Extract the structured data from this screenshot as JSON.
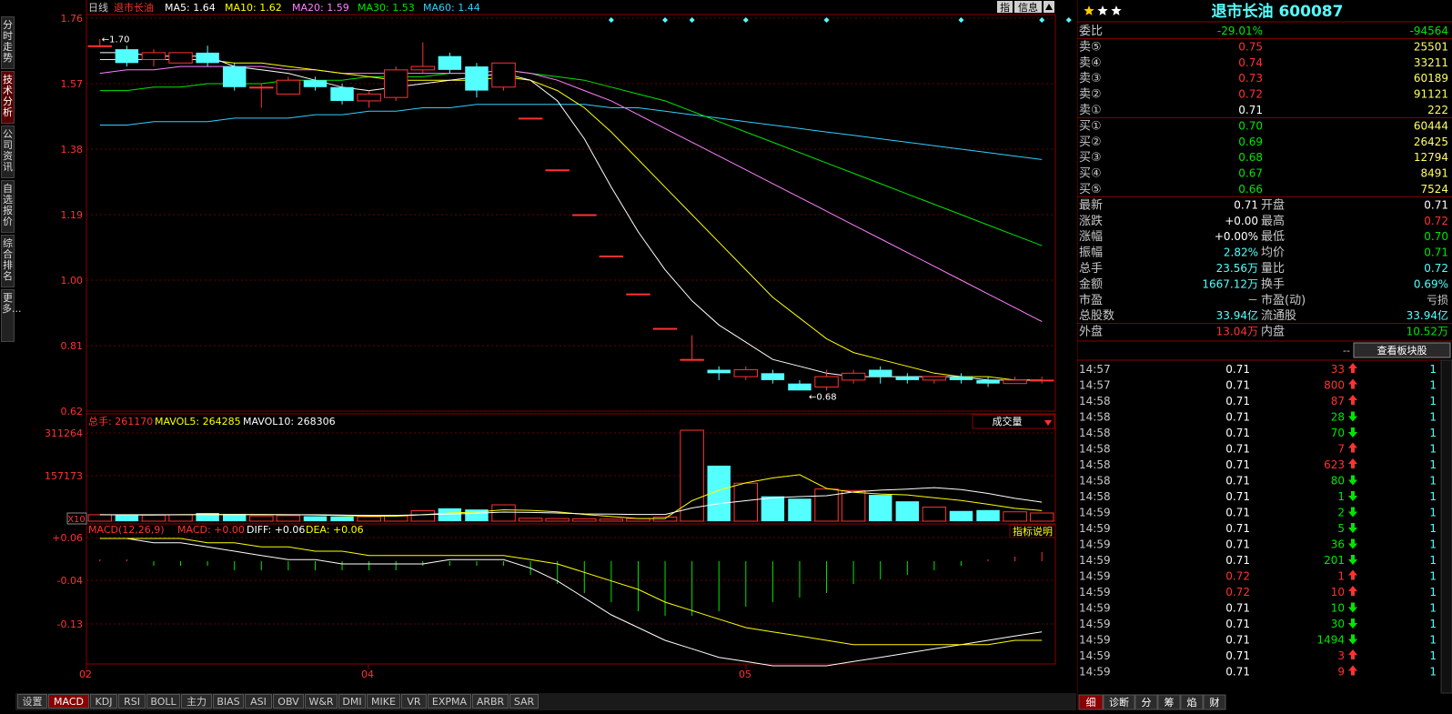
{
  "sidebar": {
    "tabs": [
      {
        "label": "分时走势",
        "active": false
      },
      {
        "label": "技术分析",
        "active": true
      },
      {
        "label": "公司资讯",
        "active": false
      },
      {
        "label": "自选报价",
        "active": false
      },
      {
        "label": "综合排名",
        "active": false
      },
      {
        "label": "更多...",
        "active": false
      }
    ]
  },
  "header": {
    "period": "日线",
    "stock_name": "退市长油",
    "ma5": "MA5: 1.64",
    "ma10": "MA10: 1.62",
    "ma20": "MA20: 1.59",
    "ma30": "MA30: 1.53",
    "ma60": "MA60: 1.44",
    "btn_zi": "指",
    "btn_info": "信息"
  },
  "price_axis": [
    "1.76",
    "1.57",
    "1.38",
    "1.19",
    "1.00",
    "0.81",
    "0.62"
  ],
  "annot": {
    "high": "←1.70",
    "low": "←0.68"
  },
  "vol_header": {
    "total": "总手: 261170",
    "mavol5": "MAVOL5: 264285",
    "mavol10": "MAVOL10: 268306",
    "dropdown": "成交量"
  },
  "vol_axis": [
    "311264",
    "157173",
    "X10"
  ],
  "macd_header": {
    "title": "MACD(12,26,9)",
    "macd": "MACD: +0.00",
    "diff": "DIFF: +0.06",
    "dea": "DEA: +0.06",
    "explain": "指标说明"
  },
  "macd_axis": [
    "+0.06",
    "-0.04",
    "-0.13"
  ],
  "x_axis": [
    "02",
    "04",
    "05"
  ],
  "colors": {
    "up": "#ff3232",
    "down": "#54ffff",
    "ma5": "#ffffff",
    "ma10": "#ffff00",
    "ma20": "#ff80ff",
    "ma30": "#00e600",
    "ma60": "#30d0ff"
  },
  "chart_data": {
    "type": "candlestick",
    "candles": [
      {
        "o": 1.68,
        "c": 1.68,
        "h": 1.7,
        "l": 1.68
      },
      {
        "o": 1.67,
        "c": 1.63,
        "h": 1.68,
        "l": 1.62
      },
      {
        "o": 1.64,
        "c": 1.66,
        "h": 1.67,
        "l": 1.62
      },
      {
        "o": 1.63,
        "c": 1.66,
        "h": 1.66,
        "l": 1.63
      },
      {
        "o": 1.66,
        "c": 1.63,
        "h": 1.68,
        "l": 1.62
      },
      {
        "o": 1.62,
        "c": 1.56,
        "h": 1.63,
        "l": 1.55
      },
      {
        "o": 1.56,
        "c": 1.56,
        "h": 1.57,
        "l": 1.5
      },
      {
        "o": 1.54,
        "c": 1.58,
        "h": 1.59,
        "l": 1.54
      },
      {
        "o": 1.58,
        "c": 1.56,
        "h": 1.59,
        "l": 1.55
      },
      {
        "o": 1.56,
        "c": 1.52,
        "h": 1.57,
        "l": 1.51
      },
      {
        "o": 1.52,
        "c": 1.54,
        "h": 1.55,
        "l": 1.5
      },
      {
        "o": 1.53,
        "c": 1.61,
        "h": 1.62,
        "l": 1.52
      },
      {
        "o": 1.61,
        "c": 1.62,
        "h": 1.69,
        "l": 1.6
      },
      {
        "o": 1.65,
        "c": 1.61,
        "h": 1.66,
        "l": 1.6
      },
      {
        "o": 1.62,
        "c": 1.55,
        "h": 1.63,
        "l": 1.53
      },
      {
        "o": 1.56,
        "c": 1.63,
        "h": 1.63,
        "l": 1.55
      },
      {
        "o": 1.47,
        "c": 1.47,
        "h": 1.47,
        "l": 1.47
      },
      {
        "o": 1.32,
        "c": 1.32,
        "h": 1.32,
        "l": 1.32
      },
      {
        "o": 1.19,
        "c": 1.19,
        "h": 1.19,
        "l": 1.19
      },
      {
        "o": 1.07,
        "c": 1.07,
        "h": 1.07,
        "l": 1.07
      },
      {
        "o": 0.96,
        "c": 0.96,
        "h": 0.96,
        "l": 0.96
      },
      {
        "o": 0.86,
        "c": 0.86,
        "h": 0.86,
        "l": 0.86
      },
      {
        "o": 0.77,
        "c": 0.77,
        "h": 0.84,
        "l": 0.77
      },
      {
        "o": 0.74,
        "c": 0.73,
        "h": 0.75,
        "l": 0.71
      },
      {
        "o": 0.72,
        "c": 0.74,
        "h": 0.75,
        "l": 0.71
      },
      {
        "o": 0.73,
        "c": 0.71,
        "h": 0.74,
        "l": 0.7
      },
      {
        "o": 0.7,
        "c": 0.68,
        "h": 0.71,
        "l": 0.68
      },
      {
        "o": 0.69,
        "c": 0.72,
        "h": 0.74,
        "l": 0.68
      },
      {
        "o": 0.71,
        "c": 0.73,
        "h": 0.74,
        "l": 0.7
      },
      {
        "o": 0.74,
        "c": 0.72,
        "h": 0.75,
        "l": 0.7
      },
      {
        "o": 0.72,
        "c": 0.71,
        "h": 0.73,
        "l": 0.7
      },
      {
        "o": 0.71,
        "c": 0.72,
        "h": 0.72,
        "l": 0.7
      },
      {
        "o": 0.72,
        "c": 0.71,
        "h": 0.73,
        "l": 0.7
      },
      {
        "o": 0.71,
        "c": 0.7,
        "h": 0.72,
        "l": 0.69
      },
      {
        "o": 0.7,
        "c": 0.71,
        "h": 0.72,
        "l": 0.7
      },
      {
        "o": 0.71,
        "c": 0.71,
        "h": 0.72,
        "l": 0.7
      }
    ],
    "ma5": [
      1.66,
      1.66,
      1.65,
      1.65,
      1.65,
      1.62,
      1.61,
      1.6,
      1.58,
      1.56,
      1.55,
      1.56,
      1.57,
      1.58,
      1.59,
      1.6,
      1.58,
      1.52,
      1.41,
      1.27,
      1.14,
      1.03,
      0.94,
      0.87,
      0.82,
      0.77,
      0.75,
      0.73,
      0.72,
      0.72,
      0.72,
      0.72,
      0.72,
      0.71,
      0.71,
      0.71
    ],
    "ma10": [
      1.64,
      1.64,
      1.64,
      1.64,
      1.64,
      1.63,
      1.63,
      1.62,
      1.61,
      1.6,
      1.59,
      1.58,
      1.58,
      1.58,
      1.58,
      1.59,
      1.58,
      1.55,
      1.5,
      1.43,
      1.35,
      1.27,
      1.19,
      1.11,
      1.03,
      0.95,
      0.89,
      0.83,
      0.79,
      0.77,
      0.75,
      0.73,
      0.72,
      0.72,
      0.71,
      0.71
    ],
    "ma20": [
      1.6,
      1.61,
      1.61,
      1.62,
      1.62,
      1.62,
      1.62,
      1.61,
      1.61,
      1.6,
      1.6,
      1.6,
      1.6,
      1.6,
      1.6,
      1.61,
      1.6,
      1.58,
      1.55,
      1.52,
      1.48,
      1.44,
      1.4,
      1.36,
      1.32,
      1.28,
      1.24,
      1.2,
      1.16,
      1.12,
      1.08,
      1.04,
      1.0,
      0.96,
      0.92,
      0.88
    ],
    "ma30": [
      1.55,
      1.55,
      1.56,
      1.56,
      1.57,
      1.57,
      1.57,
      1.58,
      1.58,
      1.58,
      1.59,
      1.59,
      1.59,
      1.6,
      1.6,
      1.61,
      1.6,
      1.59,
      1.58,
      1.56,
      1.54,
      1.52,
      1.49,
      1.46,
      1.43,
      1.4,
      1.37,
      1.34,
      1.31,
      1.28,
      1.25,
      1.22,
      1.19,
      1.16,
      1.13,
      1.1
    ],
    "ma60": [
      1.45,
      1.45,
      1.46,
      1.46,
      1.46,
      1.47,
      1.47,
      1.47,
      1.48,
      1.48,
      1.49,
      1.49,
      1.5,
      1.5,
      1.51,
      1.51,
      1.51,
      1.51,
      1.51,
      1.5,
      1.5,
      1.49,
      1.48,
      1.47,
      1.46,
      1.45,
      1.44,
      1.43,
      1.42,
      1.41,
      1.4,
      1.39,
      1.38,
      1.37,
      1.36,
      1.35
    ],
    "volume": [
      22000,
      20000,
      21000,
      22000,
      28000,
      25000,
      18000,
      19000,
      17000,
      16000,
      15000,
      18000,
      36000,
      44000,
      40000,
      56000,
      10000,
      9000,
      8000,
      7000,
      9000,
      14000,
      311264,
      190000,
      130000,
      85000,
      77000,
      110000,
      105000,
      90000,
      68000,
      48000,
      35000,
      38000,
      32000,
      28000
    ],
    "vol_ma5": [
      22000,
      21000,
      21000,
      22000,
      23000,
      23000,
      23000,
      22000,
      21000,
      19000,
      17000,
      17000,
      22000,
      28000,
      31000,
      39000,
      37000,
      32000,
      23000,
      16000,
      9000,
      9000,
      70000,
      106000,
      131000,
      148000,
      159000,
      112000,
      99000,
      93000,
      90000,
      80000,
      71000,
      58000,
      44000,
      36000
    ],
    "vol_ma10": [
      22000,
      22000,
      22000,
      22000,
      22000,
      22000,
      22000,
      22000,
      22000,
      21000,
      20000,
      20000,
      22000,
      24000,
      27000,
      31000,
      30000,
      28000,
      25000,
      24000,
      23000,
      23000,
      45000,
      60000,
      70000,
      80000,
      84000,
      87000,
      100000,
      106000,
      110000,
      115000,
      108000,
      95000,
      78000,
      65000
    ],
    "macd_hist": [
      0.0,
      0.0,
      -0.01,
      -0.01,
      -0.01,
      -0.02,
      -0.02,
      -0.02,
      -0.02,
      -0.02,
      -0.02,
      -0.02,
      -0.01,
      -0.01,
      -0.01,
      -0.01,
      -0.03,
      -0.05,
      -0.07,
      -0.09,
      -0.11,
      -0.12,
      -0.12,
      -0.11,
      -0.1,
      -0.09,
      -0.08,
      -0.07,
      -0.05,
      -0.04,
      -0.03,
      -0.02,
      -0.01,
      0.0,
      0.01,
      0.02
    ],
    "diff": [
      0.06,
      0.06,
      0.05,
      0.05,
      0.04,
      0.03,
      0.02,
      0.01,
      0.01,
      0.0,
      0.0,
      0.0,
      0.0,
      0.01,
      0.01,
      0.01,
      -0.01,
      -0.04,
      -0.08,
      -0.12,
      -0.15,
      -0.18,
      -0.2,
      -0.22,
      -0.23,
      -0.24,
      -0.24,
      -0.24,
      -0.23,
      -0.22,
      -0.21,
      -0.2,
      -0.19,
      -0.18,
      -0.17,
      -0.16
    ],
    "dea": [
      0.06,
      0.06,
      0.06,
      0.06,
      0.05,
      0.05,
      0.04,
      0.04,
      0.03,
      0.03,
      0.02,
      0.02,
      0.02,
      0.02,
      0.02,
      0.02,
      0.01,
      0.0,
      -0.02,
      -0.04,
      -0.06,
      -0.09,
      -0.11,
      -0.13,
      -0.15,
      -0.16,
      -0.17,
      -0.18,
      -0.19,
      -0.19,
      -0.19,
      -0.19,
      -0.19,
      -0.19,
      -0.18,
      -0.18
    ],
    "price_ylim": [
      0.62,
      1.76
    ],
    "macd_ylim": [
      -0.2,
      0.06
    ]
  },
  "quote": {
    "name_code": "退市长油 600087",
    "weibi": {
      "label": "委比",
      "pct": "-29.01%",
      "diff": "-94564"
    },
    "asks": [
      {
        "label": "卖⑤",
        "price": "0.75",
        "vol": "25501"
      },
      {
        "label": "卖④",
        "price": "0.74",
        "vol": "33211"
      },
      {
        "label": "卖③",
        "price": "0.73",
        "vol": "60189"
      },
      {
        "label": "卖②",
        "price": "0.72",
        "vol": "91121"
      },
      {
        "label": "卖①",
        "price": "0.71",
        "vol": "222"
      }
    ],
    "bids": [
      {
        "label": "买①",
        "price": "0.70",
        "vol": "60444"
      },
      {
        "label": "买②",
        "price": "0.69",
        "vol": "26425"
      },
      {
        "label": "买③",
        "price": "0.68",
        "vol": "12794"
      },
      {
        "label": "买④",
        "price": "0.67",
        "vol": "8491"
      },
      {
        "label": "买⑤",
        "price": "0.66",
        "vol": "7524"
      }
    ],
    "stats": [
      {
        "l1": "最新",
        "v1": "0.71",
        "c1": "#fff",
        "l2": "开盘",
        "v2": "0.71",
        "c2": "#fff"
      },
      {
        "l1": "涨跌",
        "v1": "+0.00",
        "c1": "#fff",
        "l2": "最高",
        "v2": "0.72",
        "c2": "#ff3232"
      },
      {
        "l1": "涨幅",
        "v1": "+0.00%",
        "c1": "#fff",
        "l2": "最低",
        "v2": "0.70",
        "c2": "#00e600"
      },
      {
        "l1": "振幅",
        "v1": "2.82%",
        "c1": "#54ffff",
        "l2": "均价",
        "v2": "0.71",
        "c2": "#00e600"
      },
      {
        "l1": "总手",
        "v1": "23.56万",
        "c1": "#54ffff",
        "l2": "量比",
        "v2": "0.72",
        "c2": "#54ffff"
      },
      {
        "l1": "金额",
        "v1": "1667.12万",
        "c1": "#54ffff",
        "l2": "换手",
        "v2": "0.69%",
        "c2": "#54ffff"
      },
      {
        "l1": "市盈",
        "v1": "－",
        "c1": "#c8c8c8",
        "l2": "市盈(动)",
        "v2": "亏损",
        "c2": "#c8c8c8"
      },
      {
        "l1": "总股数",
        "v1": "33.94亿",
        "c1": "#54ffff",
        "l2": "流通股",
        "v2": "33.94亿",
        "c2": "#54ffff"
      }
    ],
    "waipan": {
      "label": "外盘",
      "value": "13.04万",
      "label2": "内盘",
      "value2": "10.52万"
    },
    "dashes": "--",
    "view_btn": "查看板块股"
  },
  "ticks": [
    {
      "t": "14:57",
      "p": "0.71",
      "pc": "#fff",
      "v": "33",
      "vc": "#ff3232",
      "d": "up",
      "n": "1"
    },
    {
      "t": "14:57",
      "p": "0.71",
      "pc": "#fff",
      "v": "800",
      "vc": "#ff3232",
      "d": "up",
      "n": "1"
    },
    {
      "t": "14:58",
      "p": "0.71",
      "pc": "#fff",
      "v": "87",
      "vc": "#ff3232",
      "d": "up",
      "n": "1"
    },
    {
      "t": "14:58",
      "p": "0.71",
      "pc": "#fff",
      "v": "28",
      "vc": "#00e600",
      "d": "down",
      "n": "1"
    },
    {
      "t": "14:58",
      "p": "0.71",
      "pc": "#fff",
      "v": "70",
      "vc": "#00e600",
      "d": "down",
      "n": "1"
    },
    {
      "t": "14:58",
      "p": "0.71",
      "pc": "#fff",
      "v": "7",
      "vc": "#ff3232",
      "d": "up",
      "n": "1"
    },
    {
      "t": "14:58",
      "p": "0.71",
      "pc": "#fff",
      "v": "623",
      "vc": "#ff3232",
      "d": "up",
      "n": "1"
    },
    {
      "t": "14:58",
      "p": "0.71",
      "pc": "#fff",
      "v": "80",
      "vc": "#00e600",
      "d": "down",
      "n": "1"
    },
    {
      "t": "14:58",
      "p": "0.71",
      "pc": "#fff",
      "v": "1",
      "vc": "#00e600",
      "d": "down",
      "n": "1"
    },
    {
      "t": "14:59",
      "p": "0.71",
      "pc": "#fff",
      "v": "2",
      "vc": "#00e600",
      "d": "down",
      "n": "1"
    },
    {
      "t": "14:59",
      "p": "0.71",
      "pc": "#fff",
      "v": "5",
      "vc": "#00e600",
      "d": "down",
      "n": "1"
    },
    {
      "t": "14:59",
      "p": "0.71",
      "pc": "#fff",
      "v": "36",
      "vc": "#00e600",
      "d": "down",
      "n": "1"
    },
    {
      "t": "14:59",
      "p": "0.71",
      "pc": "#fff",
      "v": "201",
      "vc": "#00e600",
      "d": "down",
      "n": "1"
    },
    {
      "t": "14:59",
      "p": "0.72",
      "pc": "#ff3232",
      "v": "1",
      "vc": "#ff3232",
      "d": "up",
      "n": "1"
    },
    {
      "t": "14:59",
      "p": "0.72",
      "pc": "#ff3232",
      "v": "10",
      "vc": "#ff3232",
      "d": "up",
      "n": "1"
    },
    {
      "t": "14:59",
      "p": "0.71",
      "pc": "#fff",
      "v": "10",
      "vc": "#00e600",
      "d": "down",
      "n": "1"
    },
    {
      "t": "14:59",
      "p": "0.71",
      "pc": "#fff",
      "v": "30",
      "vc": "#00e600",
      "d": "down",
      "n": "1"
    },
    {
      "t": "14:59",
      "p": "0.71",
      "pc": "#fff",
      "v": "1494",
      "vc": "#00e600",
      "d": "down",
      "n": "1"
    },
    {
      "t": "14:59",
      "p": "0.71",
      "pc": "#fff",
      "v": "3",
      "vc": "#ff3232",
      "d": "up",
      "n": "1"
    },
    {
      "t": "14:59",
      "p": "0.71",
      "pc": "#fff",
      "v": "9",
      "vc": "#ff3232",
      "d": "up",
      "n": "1"
    }
  ],
  "bottom_tabs": [
    "设置",
    "MACD",
    "KDJ",
    "RSI",
    "BOLL",
    "主力",
    "BIAS",
    "ASI",
    "OBV",
    "W&R",
    "DMI",
    "MIKE",
    "VR",
    "EXPMA",
    "ARBR",
    "SAR"
  ],
  "right_tabs": [
    "细",
    "诊断",
    "分",
    "筹",
    "焰",
    "财"
  ]
}
